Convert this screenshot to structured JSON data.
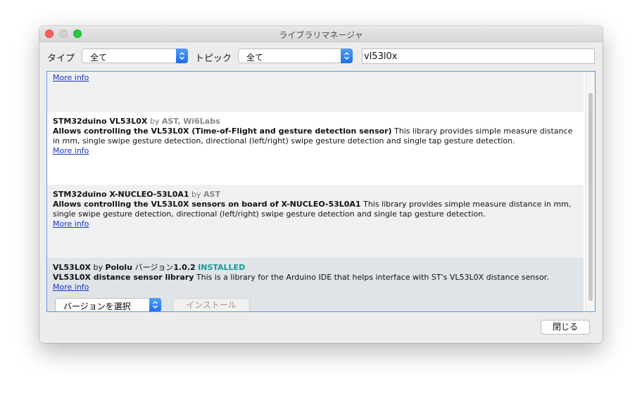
{
  "window": {
    "title": "ライブラリマネージャ"
  },
  "toolbar": {
    "type_label": "タイプ",
    "type_value": "全て",
    "topic_label": "トピック",
    "topic_value": "全て",
    "search_value": "vl53l0x"
  },
  "entries": [
    {
      "more_info": "More info"
    },
    {
      "name": "STM32duino VL53L0X",
      "by": "by",
      "author": "AST, Wi6Labs",
      "summary": "Allows controlling the VL53L0X (Time-of-Flight and gesture detection sensor)",
      "description": "This library provides simple measure distance in mm, single swipe gesture detection, directional (left/right) swipe gesture detection and single tap gesture detection.",
      "more_info": "More info"
    },
    {
      "name": "STM32duino X-NUCLEO-53L0A1",
      "by": "by",
      "author": "AST",
      "summary": "Allows controlling the VL53L0X sensors on board of X-NUCLEO-53L0A1",
      "description": "This library provides simple measure distance in mm, single swipe gesture detection, directional (left/right) swipe gesture detection and single tap gesture detection.",
      "more_info": "More info"
    },
    {
      "name": "VL53L0X",
      "by": "by",
      "author": "Pololu",
      "version_label": "バージョン",
      "version": "1.0.2",
      "status": "INSTALLED",
      "summary": "VL53L0X distance sensor library",
      "description": "This is a library for the Arduino IDE that helps interface with ST's VL53L0X distance sensor.",
      "more_info": "More info",
      "version_select": "バージョンを選択",
      "install_button": "インストール"
    }
  ],
  "footer": {
    "close_button": "閉じる"
  },
  "colors": {
    "link": "#1a35c8",
    "installed": "#1a9a9a",
    "accent": "#1d6ef0",
    "list_border": "#5b9be6"
  }
}
